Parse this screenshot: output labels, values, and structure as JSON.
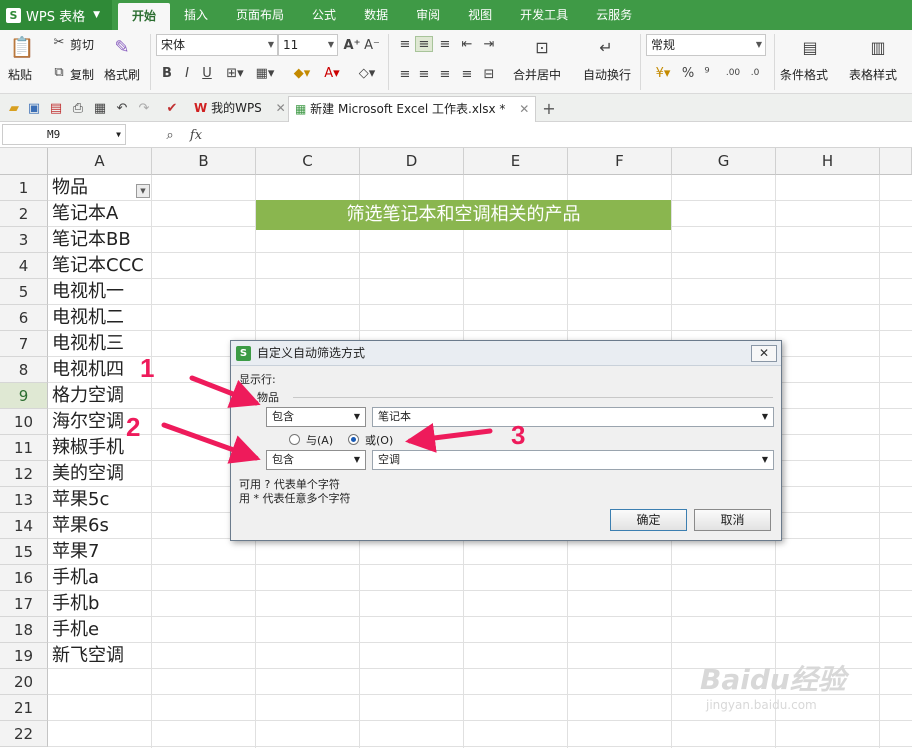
{
  "app": {
    "name": "WPS 表格",
    "logo": "S"
  },
  "menu": {
    "tabs": [
      "开始",
      "插入",
      "页面布局",
      "公式",
      "数据",
      "审阅",
      "视图",
      "开发工具",
      "云服务"
    ],
    "active": "开始"
  },
  "ribbon": {
    "cut": "剪切",
    "paste": "粘贴",
    "copy": "复制",
    "format_painter": "格式刷",
    "font_name": "宋体",
    "font_size": "11",
    "bold": "B",
    "italic": "I",
    "underline": "U",
    "merge_center": "合并居中",
    "wrap_text": "自动换行",
    "number_format": "常规",
    "percent": "%",
    "thousands": "⁹",
    "conditional_format": "条件格式",
    "table_style": "表格样式"
  },
  "doc_tabs": [
    {
      "label": "我的WPS",
      "active": false
    },
    {
      "label": "新建 Microsoft Excel 工作表.xlsx *",
      "active": true
    }
  ],
  "formula": {
    "name_box": "M9",
    "fx": "fx"
  },
  "columns": [
    "A",
    "B",
    "C",
    "D",
    "E",
    "F",
    "G",
    "H"
  ],
  "rows": [
    "1",
    "2",
    "3",
    "4",
    "5",
    "6",
    "7",
    "8",
    "9",
    "10",
    "11",
    "12",
    "13",
    "14",
    "15",
    "16",
    "17",
    "18",
    "19",
    "20",
    "21",
    "22"
  ],
  "selected_row": "9",
  "col_a": [
    "物品",
    "笔记本A",
    "笔记本BB",
    "笔记本CCC",
    "电视机一",
    "电视机二",
    "电视机三",
    "电视机四",
    "格力空调",
    "海尔空调",
    "辣椒手机",
    "美的空调",
    "苹果5c",
    "苹果6s",
    "苹果7",
    "手机a",
    "手机b",
    "手机e",
    "新飞空调"
  ],
  "banner": {
    "text": "筛选笔记本和空调相关的产品",
    "color": "#8ab64f"
  },
  "dialog": {
    "title": "自定义自动筛选方式",
    "show_rows": "显示行:",
    "field": "物品",
    "cond1_op": "包含",
    "cond1_value": "笔记本",
    "and_label": "与(A)",
    "or_label": "或(O)",
    "logic": "or",
    "cond2_op": "包含",
    "cond2_value": "空调",
    "hint1": "可用 ? 代表单个字符",
    "hint2": "用 * 代表任意多个字符",
    "ok": "确定",
    "cancel": "取消"
  },
  "annotations": {
    "n1": "1",
    "n2": "2",
    "n3": "3",
    "color": "#ee1b5b"
  },
  "watermark": {
    "main": "Baidu经验",
    "sub": "jingyan.baidu.com"
  }
}
